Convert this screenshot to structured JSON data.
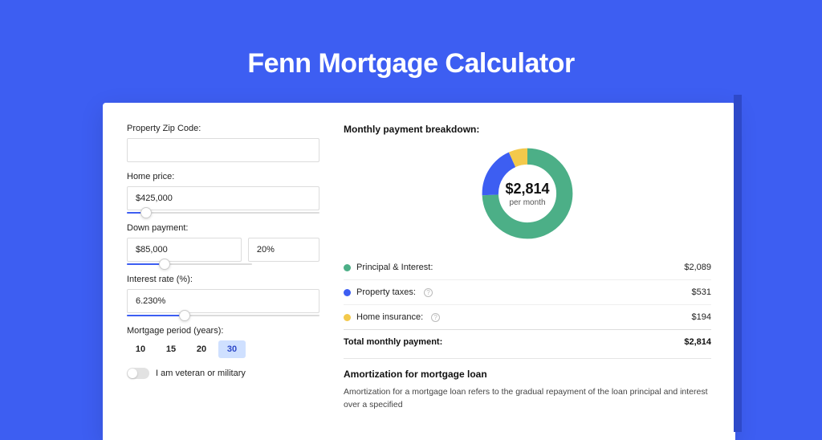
{
  "title": "Fenn Mortgage Calculator",
  "form": {
    "zip_label": "Property Zip Code:",
    "zip_value": "",
    "home_price_label": "Home price:",
    "home_price_value": "$425,000",
    "home_price_slider_pct": 10,
    "down_payment_label": "Down payment:",
    "down_payment_value": "$85,000",
    "down_payment_pct": "20%",
    "down_payment_slider_pct": 20,
    "interest_label": "Interest rate (%):",
    "interest_value": "6.230%",
    "interest_slider_pct": 30,
    "period_label": "Mortgage period (years):",
    "periods": [
      "10",
      "15",
      "20",
      "30"
    ],
    "period_selected": "30",
    "veteran_label": "I am veteran or military"
  },
  "breakdown": {
    "heading": "Monthly payment breakdown:",
    "center_amount": "$2,814",
    "center_sub": "per month",
    "items": [
      {
        "label": "Principal & Interest:",
        "value": "$2,089",
        "color": "#4caf87",
        "info": false
      },
      {
        "label": "Property taxes:",
        "value": "$531",
        "color": "#3d5ef2",
        "info": true
      },
      {
        "label": "Home insurance:",
        "value": "$194",
        "color": "#f3c94b",
        "info": true
      }
    ],
    "total_label": "Total monthly payment:",
    "total_value": "$2,814"
  },
  "amort": {
    "heading": "Amortization for mortgage loan",
    "text": "Amortization for a mortgage loan refers to the gradual repayment of the loan principal and interest over a specified"
  },
  "chart_data": {
    "type": "pie",
    "title": "Monthly payment breakdown",
    "series": [
      {
        "name": "Principal & Interest",
        "value": 2089,
        "color": "#4caf87"
      },
      {
        "name": "Property taxes",
        "value": 531,
        "color": "#3d5ef2"
      },
      {
        "name": "Home insurance",
        "value": 194,
        "color": "#f3c94b"
      }
    ],
    "total": 2814,
    "center_label": "$2,814 per month"
  }
}
